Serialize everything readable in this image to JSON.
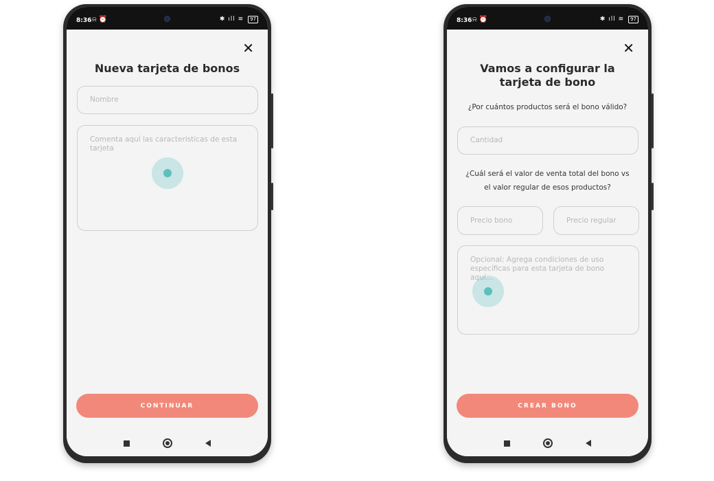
{
  "status": {
    "time": "8:36",
    "left_icons": "⍾ ⏰",
    "right_icons": "✱ ıll ≋",
    "battery": "97"
  },
  "screen_left": {
    "close_icon": "✕",
    "title": "Nueva tarjeta de bonos",
    "name_placeholder": "Nombre",
    "description_placeholder": "Comenta aquí las características de esta tarjeta",
    "continue_label": "CONTINUAR"
  },
  "screen_right": {
    "close_icon": "✕",
    "title": "Vamos a configurar la tarjeta de bono",
    "question_quantity": "¿Por cuántos productos será el bono válido?",
    "quantity_placeholder": "Cantidad",
    "question_value": "¿Cuál será el valor de venta total del bono vs el valor regular de esos productos?",
    "bono_price_placeholder": "Precio bono",
    "regular_price_placeholder": "Precio regular",
    "conditions_placeholder": "Opcional: Agrega condiciones de uso específicas para esta tarjeta de bono aquí...",
    "create_label": "CREAR BONO"
  },
  "colors": {
    "accent": "#f2887a",
    "touch_indicator": "#5cc0bd",
    "background": "#f4f4f4"
  }
}
